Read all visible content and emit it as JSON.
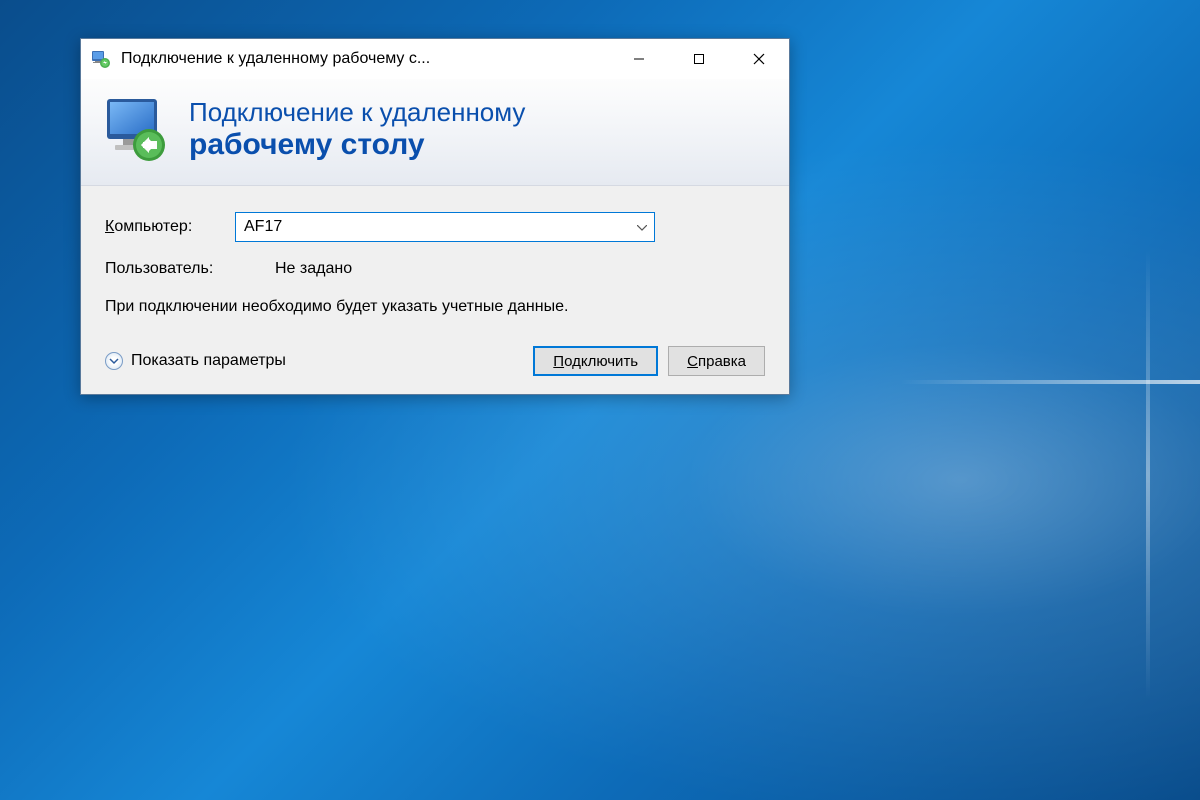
{
  "window": {
    "title": "Подключение к удаленному рабочему с..."
  },
  "banner": {
    "line1": "Подключение к удаленному",
    "line2": "рабочему столу"
  },
  "form": {
    "computer_label_prefix": "К",
    "computer_label_rest": "омпьютер:",
    "computer_value": "AF17",
    "user_label": "Пользователь:",
    "user_value": "Не задано",
    "info_text": "При подключении необходимо будет указать учетные данные."
  },
  "footer": {
    "show_params_prefix": "П",
    "show_params_rest": "оказать параметры",
    "connect_prefix": "П",
    "connect_rest": "одключить",
    "help_prefix": "С",
    "help_rest": "правка"
  }
}
